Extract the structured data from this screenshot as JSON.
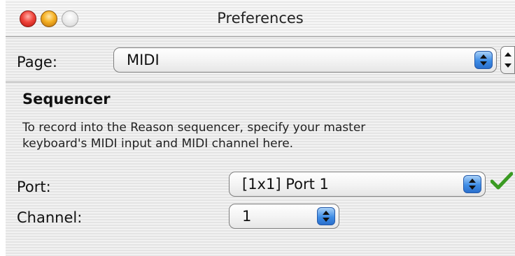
{
  "window": {
    "title": "Preferences"
  },
  "page_selector": {
    "label": "Page:",
    "value": "MIDI"
  },
  "section": {
    "heading": "Sequencer",
    "description": "To record into the Reason sequencer, specify your master\nkeyboard's MIDI input and MIDI channel here."
  },
  "port": {
    "label": "Port:",
    "value": "[1x1] Port 1",
    "status_icon": "green-checkmark-icon",
    "status_color": "#3a9a22"
  },
  "channel": {
    "label": "Channel:",
    "value": "1"
  },
  "colors": {
    "accent": "#3f8de6"
  }
}
